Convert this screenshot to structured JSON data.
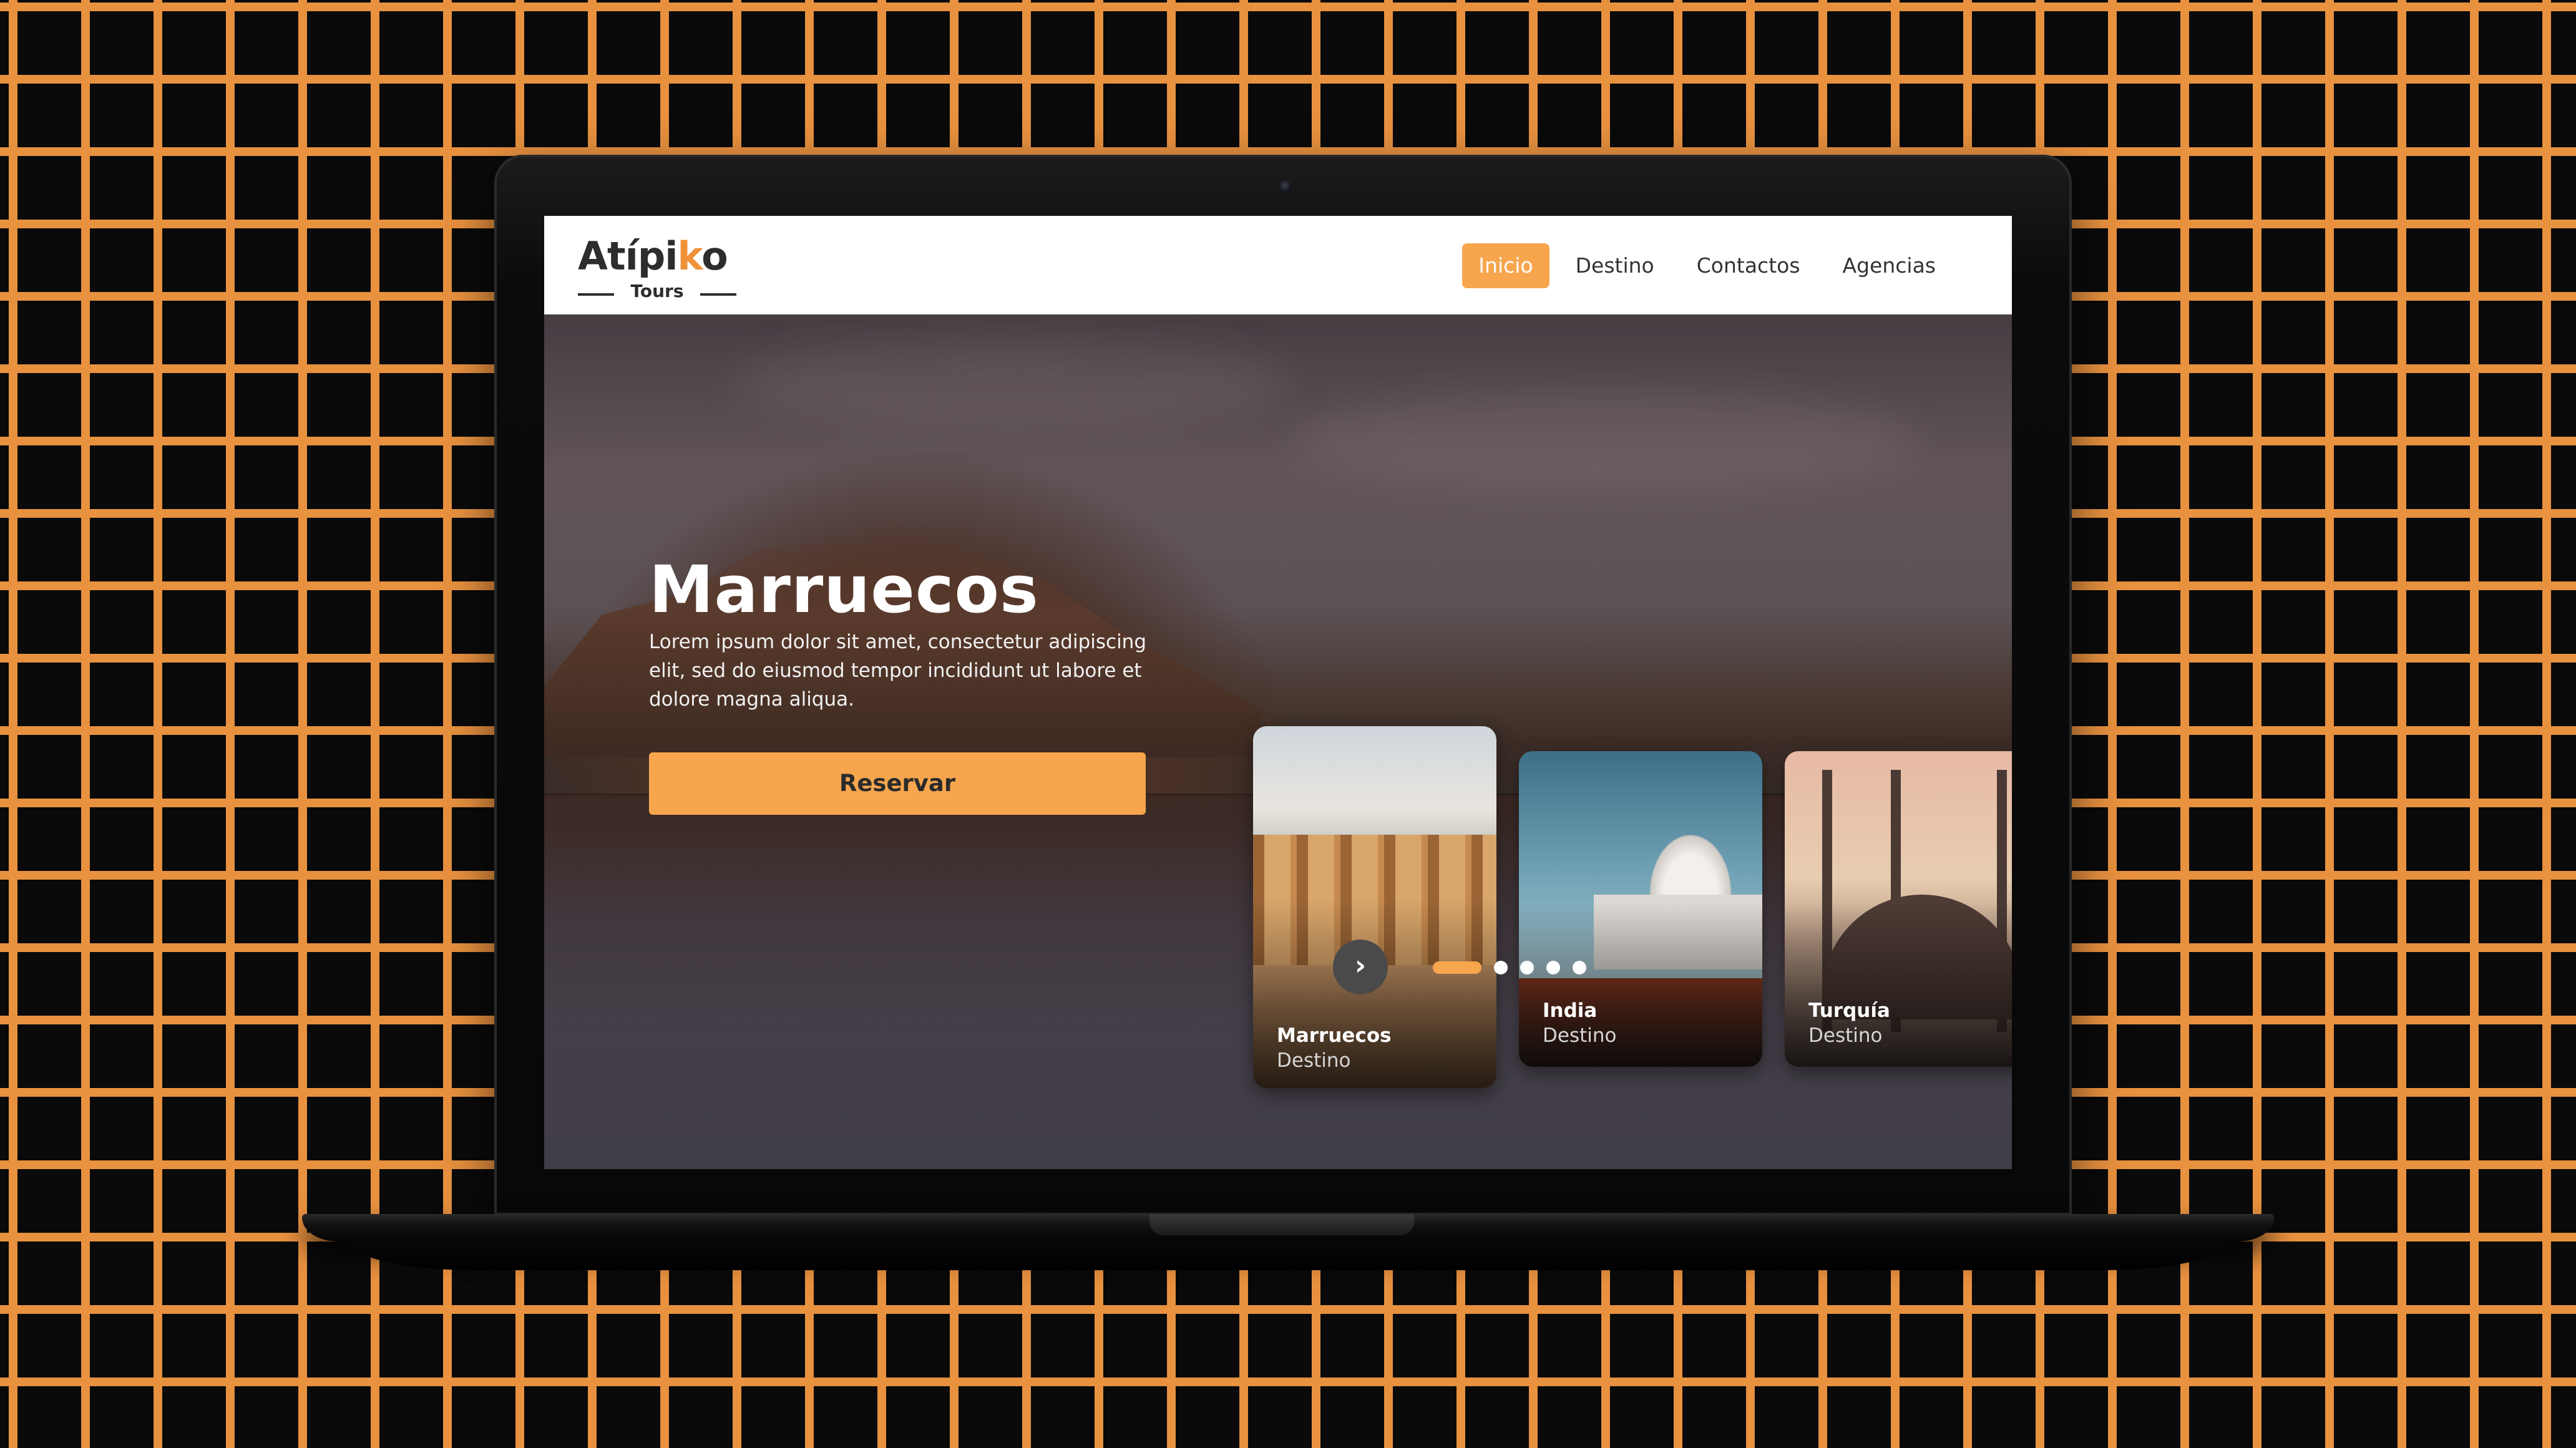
{
  "brand": {
    "name_prefix": "Atípi",
    "name_k": "k",
    "name_suffix": "o",
    "tagline": "Tours",
    "accent_color": "#f7a64e"
  },
  "nav": {
    "items": [
      {
        "label": "Inicio",
        "active": true
      },
      {
        "label": "Destino",
        "active": false
      },
      {
        "label": "Contactos",
        "active": false
      },
      {
        "label": "Agencias",
        "active": false
      }
    ]
  },
  "hero": {
    "title": "Marruecos",
    "description": "Lorem ipsum dolor sit amet, consectetur adipiscing elit, sed do eiusmod tempor incididunt ut labore et dolore magna aliqua.",
    "cta_label": "Reservar"
  },
  "destinations": [
    {
      "name": "Marruecos",
      "subtitle": "Destino"
    },
    {
      "name": "India",
      "subtitle": "Destino"
    },
    {
      "name": "Turquía",
      "subtitle": "Destino"
    }
  ],
  "slider": {
    "next_icon": "chevron-right-icon",
    "total_slides": 5,
    "active_slide": 1
  }
}
